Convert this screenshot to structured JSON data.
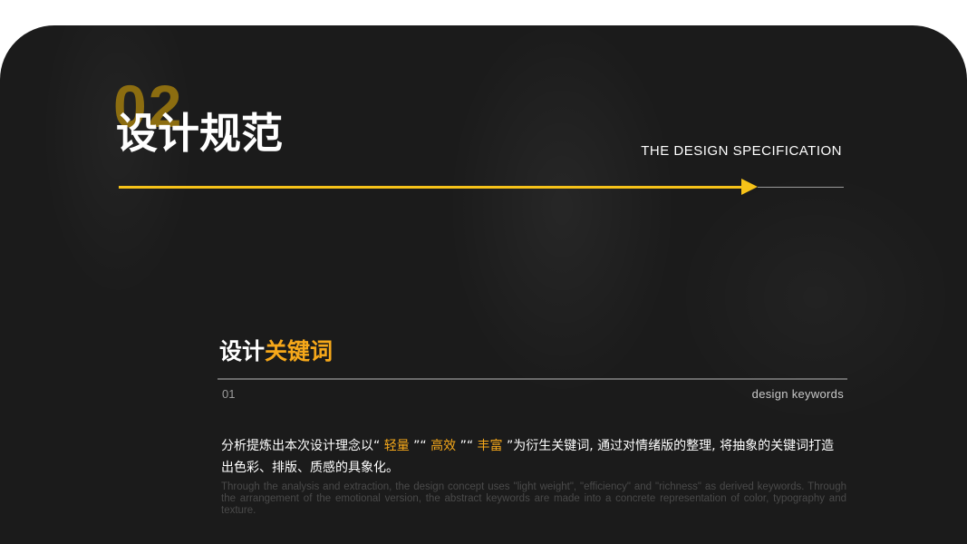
{
  "header": {
    "number": "02",
    "title": "设计规范",
    "subtitle": "THE DESIGN SPECIFICATION"
  },
  "colors": {
    "accent": "#f6c219",
    "number": "#8c6d10",
    "keyword": "#f6a81a",
    "background": "#1b1b1b"
  },
  "section": {
    "title_white": "设计",
    "title_accent": "关键词",
    "index": "01",
    "label_en": "design keywords"
  },
  "paragraph": {
    "prefix": "分析提炼出本次设计理念以“",
    "kw1": " 轻量 ",
    "sep1": "”“",
    "kw2": " 高效 ",
    "sep2": "”“",
    "kw3": " 丰富 ",
    "suffix": "”为衍生关键词, 通过对情绪版的整理, 将抽象的关键词打造出色彩、排版、质感的具象化。"
  },
  "english_text": "Through the analysis and extraction, the design concept uses \"light weight\", \"efficiency\" and \"richness\" as derived keywords. Through the arrangement of the emotional version, the abstract keywords are made into a concrete representation of color, typography and texture."
}
